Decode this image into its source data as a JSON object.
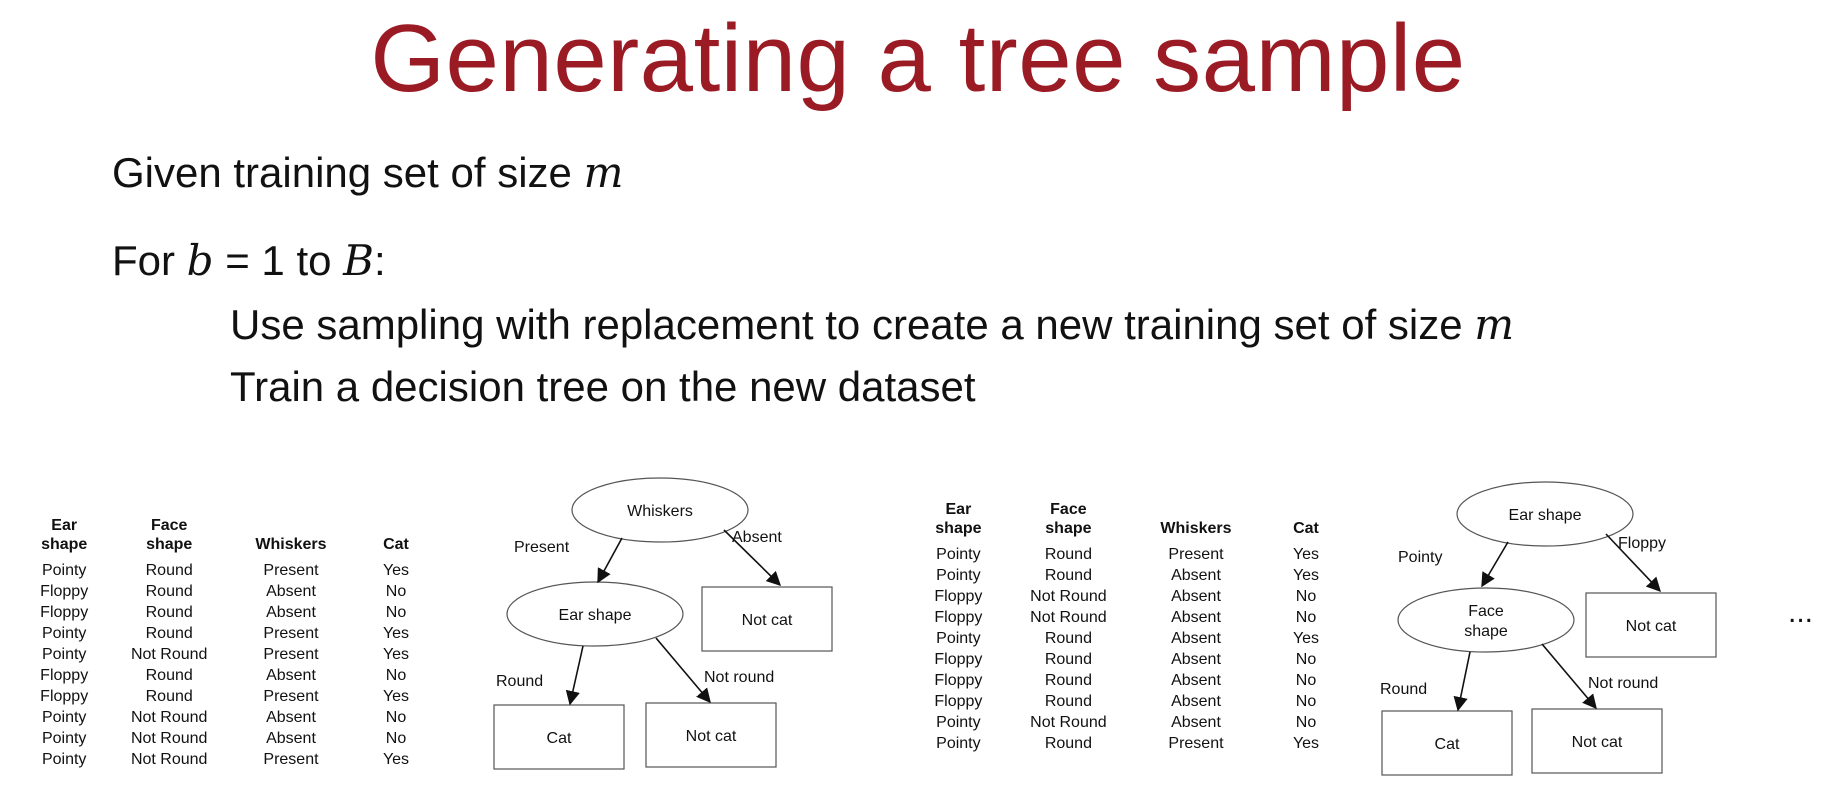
{
  "slide": {
    "title": "Generating a tree sample",
    "line1_text": "Given training set of size ",
    "line1_var": "m",
    "line2_pre": "For ",
    "line2_var_b": "b",
    "line2_mid": " = 1 to ",
    "line2_var_B": "B",
    "line2_post": ":",
    "line3_text": "Use sampling with replacement to create a new training set of size ",
    "line3_var": "m",
    "line4_text": "Train a decision tree on the new dataset",
    "ellipsis": "..."
  },
  "table1": {
    "headers": [
      [
        "Ear",
        "shape"
      ],
      [
        "Face",
        "shape"
      ],
      [
        "Whiskers"
      ],
      [
        "Cat"
      ]
    ],
    "rows": [
      [
        "Pointy",
        "Round",
        "Present",
        "Yes"
      ],
      [
        "Floppy",
        "Round",
        "Absent",
        "No"
      ],
      [
        "Floppy",
        "Round",
        "Absent",
        "No"
      ],
      [
        "Pointy",
        "Round",
        "Present",
        "Yes"
      ],
      [
        "Pointy",
        "Not Round",
        "Present",
        "Yes"
      ],
      [
        "Floppy",
        "Round",
        "Absent",
        "No"
      ],
      [
        "Floppy",
        "Round",
        "Present",
        "Yes"
      ],
      [
        "Pointy",
        "Not Round",
        "Absent",
        "No"
      ],
      [
        "Pointy",
        "Not Round",
        "Absent",
        "No"
      ],
      [
        "Pointy",
        "Not Round",
        "Present",
        "Yes"
      ]
    ]
  },
  "table2": {
    "headers": [
      [
        "Ear",
        "shape"
      ],
      [
        "Face",
        "shape"
      ],
      [
        "Whiskers"
      ],
      [
        "Cat"
      ]
    ],
    "rows": [
      [
        "Pointy",
        "Round",
        "Present",
        "Yes"
      ],
      [
        "Pointy",
        "Round",
        "Absent",
        "Yes"
      ],
      [
        "Floppy",
        "Not Round",
        "Absent",
        "No"
      ],
      [
        "Floppy",
        "Not Round",
        "Absent",
        "No"
      ],
      [
        "Pointy",
        "Round",
        "Absent",
        "Yes"
      ],
      [
        "Floppy",
        "Round",
        "Absent",
        "No"
      ],
      [
        "Floppy",
        "Round",
        "Absent",
        "No"
      ],
      [
        "Floppy",
        "Round",
        "Absent",
        "No"
      ],
      [
        "Pointy",
        "Not Round",
        "Absent",
        "No"
      ],
      [
        "Pointy",
        "Round",
        "Present",
        "Yes"
      ]
    ]
  },
  "tree1": {
    "root": "Whiskers",
    "root_left_edge": "Present",
    "root_right_edge": "Absent",
    "child": "Ear shape",
    "child_left_edge": "Round",
    "child_right_edge": "Not round",
    "leaf_right_of_root": "Not cat",
    "leaf_left": "Cat",
    "leaf_right": "Not cat"
  },
  "tree2": {
    "root": "Ear shape",
    "root_left_edge": "Pointy",
    "root_right_edge": "Floppy",
    "child_line1": "Face",
    "child_line2": "shape",
    "child_left_edge": "Round",
    "child_right_edge": "Not round",
    "leaf_right_of_root": "Not cat",
    "leaf_left": "Cat",
    "leaf_right": "Not cat"
  }
}
